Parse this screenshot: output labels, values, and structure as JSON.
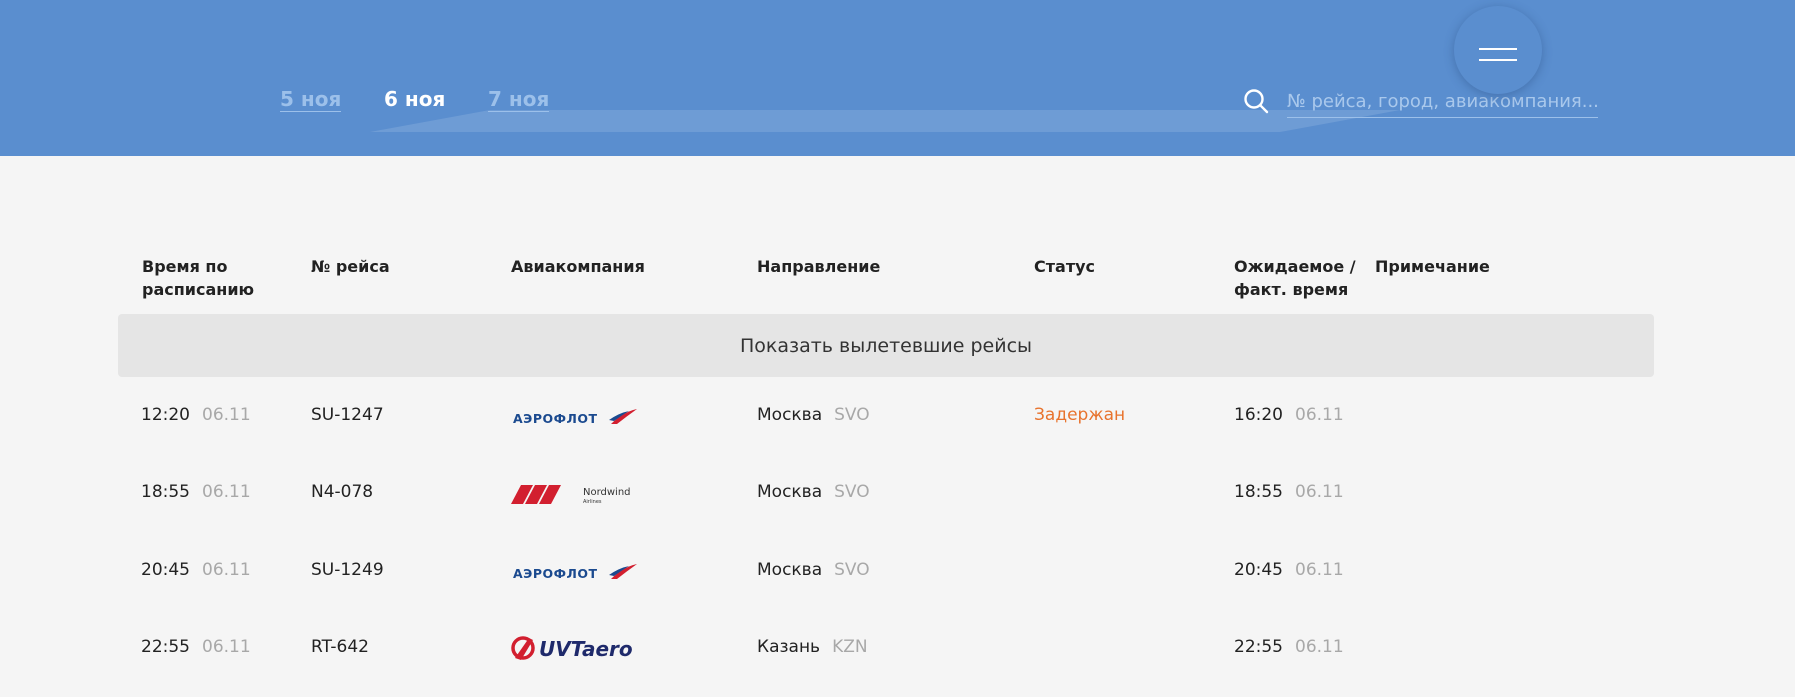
{
  "header": {
    "date_tabs": [
      {
        "label": "5 ноя",
        "active": false
      },
      {
        "label": "6 ноя",
        "active": true
      },
      {
        "label": "7 ноя",
        "active": false
      }
    ],
    "search": {
      "placeholder": "№ рейса, город, авиакомпания..."
    },
    "icons": {
      "search": "search-icon",
      "menu": "hamburger-menu-icon"
    }
  },
  "table": {
    "columns": [
      "Время по расписанию",
      "№ рейса",
      "Авиакомпания",
      "Направление",
      "Статус",
      "Ожидаемое / факт. время",
      "Примечание"
    ],
    "show_departed_label": "Показать вылетевшие рейсы",
    "rows": [
      {
        "time": "12:20",
        "date": "06.11",
        "flight": "SU-1247",
        "airline": "Аэрофлот",
        "airline_logo_text": "АЭРОФЛОТ",
        "city": "Москва",
        "code": "SVO",
        "status": "Задержан",
        "actual_time": "16:20",
        "actual_date": "06.11",
        "note": ""
      },
      {
        "time": "18:55",
        "date": "06.11",
        "flight": "N4-078",
        "airline": "Nordwind Airlines",
        "airline_logo_text": "Nordwind",
        "airline_logo_sub": "Airlines",
        "city": "Москва",
        "code": "SVO",
        "status": "",
        "actual_time": "18:55",
        "actual_date": "06.11",
        "note": ""
      },
      {
        "time": "20:45",
        "date": "06.11",
        "flight": "SU-1249",
        "airline": "Аэрофлот",
        "airline_logo_text": "АЭРОФЛОТ",
        "city": "Москва",
        "code": "SVO",
        "status": "",
        "actual_time": "20:45",
        "actual_date": "06.11",
        "note": ""
      },
      {
        "time": "22:55",
        "date": "06.11",
        "flight": "RT-642",
        "airline": "UVT aero",
        "airline_logo_text": "UVTaero",
        "city": "Казань",
        "code": "KZN",
        "status": "",
        "actual_time": "22:55",
        "actual_date": "06.11",
        "note": ""
      }
    ]
  },
  "colors": {
    "header_bg": "#5a8ecf",
    "delayed": "#e8732d",
    "muted": "#a8a8a8",
    "aeroflot_blue": "#1b4a8f",
    "nordwind_red": "#d21f2f",
    "uvt_navy": "#1f2a6b"
  }
}
